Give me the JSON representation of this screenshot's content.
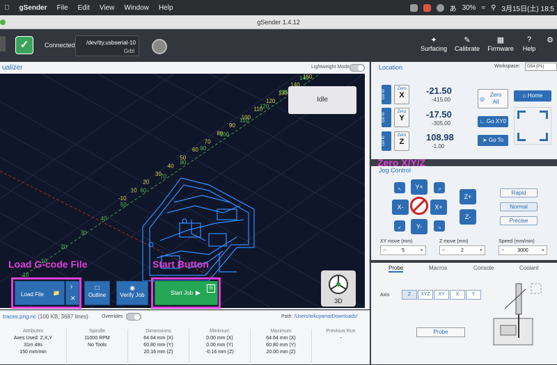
{
  "mac_menubar": {
    "app": "gSender",
    "items": [
      "File",
      "Edit",
      "View",
      "Window",
      "Help"
    ],
    "battery": "30%",
    "ime": "あ",
    "datetime": "3月15日(土) 18:5"
  },
  "window": {
    "title": "gSender 1.4.12"
  },
  "connection": {
    "status": "Connected",
    "port": "/dev/tty.usbserial-10",
    "firmware": "Grbl"
  },
  "toolbar": {
    "items": [
      {
        "label": "Surfacing",
        "icon": "surfacing-icon"
      },
      {
        "label": "Calibrate",
        "icon": "calibrate-icon"
      },
      {
        "label": "Firmware",
        "icon": "firmware-icon"
      },
      {
        "label": "Help",
        "icon": "help-icon"
      }
    ]
  },
  "visualizer": {
    "title": "ualizer",
    "lightweight_mode": "Lightweight Mode",
    "state": "Idle",
    "view_label": "3D",
    "axis_ticks_x": [
      "-10",
      "10",
      "20",
      "30",
      "40",
      "50",
      "60",
      "70",
      "80",
      "90",
      "100",
      "110",
      "120",
      "130",
      "140",
      "150"
    ],
    "axis_ticks_y": [
      "-10",
      "10",
      "20",
      "30",
      "40",
      "50",
      "60",
      "70",
      "80",
      "90",
      "100",
      "110",
      "120",
      "130",
      "140"
    ],
    "buttons": {
      "load_file": "Load File",
      "outline": "Outline",
      "verify_job": "Verify Job",
      "start_job": "Start Job"
    }
  },
  "annotations": {
    "load_gcode": "Load G-code File",
    "start_button": "Start Button",
    "zero_xyz": "Zero X/Y/Z"
  },
  "file_info": {
    "name": "traces.png.nc",
    "meta": "(100 KB, 3687 lines)",
    "overrides": "Overrides",
    "path_label": "Path:",
    "path": "/Users/tokuyama/Downloads/"
  },
  "stats": [
    {
      "header": "Attributes",
      "lines": [
        "Axes Used: Z,X,Y",
        "31m 49s",
        "150 mm/min"
      ]
    },
    {
      "header": "Spindle",
      "lines": [
        "",
        "11000 RPM",
        "No Tools"
      ]
    },
    {
      "header": "Dimensions",
      "lines": [
        "64.64 mm (X)",
        "60.80 mm (Y)",
        "20.16 mm (Z)"
      ]
    },
    {
      "header": "Minimum",
      "lines": [
        "0.00 mm (X)",
        "0.00 mm (Y)",
        "-0.16 mm (Z)"
      ]
    },
    {
      "header": "Maximum",
      "lines": [
        "64.64 mm (X)",
        "60.80 mm (Y)",
        "20.00 mm (Z)"
      ]
    },
    {
      "header": "Previous Run",
      "lines": [
        "",
        "-",
        ""
      ]
    }
  ],
  "location": {
    "title": "Location",
    "workspace_label": "Workspace:",
    "workspace": "G54 (P1)",
    "goto_label": "Go to",
    "zero_label": "Zero",
    "axes": [
      {
        "axis": "X",
        "value": "-21.50",
        "machine": "-415.00"
      },
      {
        "axis": "Y",
        "value": "-17.50",
        "machine": "-305.00"
      },
      {
        "axis": "Z",
        "value": "108.98",
        "machine": "-1.00"
      }
    ],
    "zero_all": "Zero All",
    "home": "Home",
    "go_xy0": "Go XY0",
    "go_to": "Go To"
  },
  "jog": {
    "title": "Jog Control",
    "xy_labels": [
      "Y+",
      "X-",
      "X+",
      "Y-"
    ],
    "z_labels": [
      "Z+",
      "Z-"
    ],
    "speeds": [
      "Rapid",
      "Normal",
      "Precise"
    ],
    "active_speed": "Normal",
    "xy_move_label": "XY move (mm)",
    "xy_move": "5",
    "z_move_label": "Z move (mm)",
    "z_move": "2",
    "speed_label": "Speed (mm/min)",
    "speed": "3000"
  },
  "tabs": {
    "items": [
      "Probe",
      "Macros",
      "Console",
      "Coolant"
    ],
    "active": "Probe",
    "axis_label": "Axis",
    "axis_options": [
      "Z",
      "XYZ",
      "XY",
      "X",
      "Y"
    ],
    "axis_active": "Z",
    "probe_button": "Probe"
  },
  "colors": {
    "accent": "#2d6db3",
    "start": "#26a657",
    "highlight": "#e23fd9",
    "canvas": "#10162a",
    "toolpath": "#2f8fff"
  }
}
